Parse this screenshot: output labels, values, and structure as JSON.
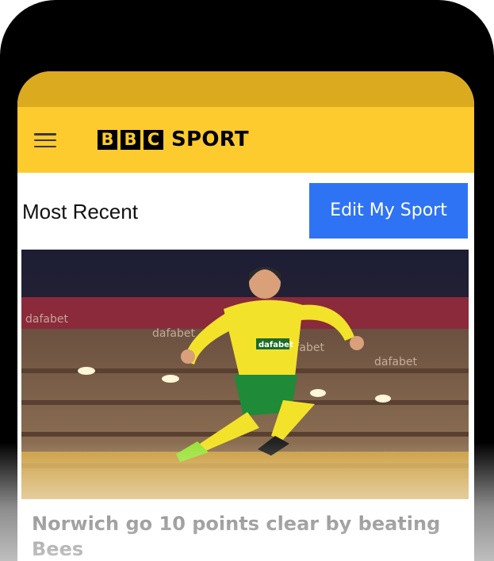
{
  "header": {
    "logo_letters": [
      "B",
      "B",
      "C"
    ],
    "logo_word": "SPORT",
    "brand_color": "#fdcb2d",
    "menu_icon": "hamburger-menu-icon"
  },
  "section": {
    "title": "Most Recent",
    "edit_button_label": "Edit My Sport",
    "accent_color": "#2f73f5"
  },
  "article": {
    "headline": "Norwich go 10 points clear by beating Bees",
    "image_signage": [
      "dafabet",
      "dafabet",
      "dafabet",
      "dafabet"
    ],
    "shirt_sponsor": "dafabet"
  }
}
